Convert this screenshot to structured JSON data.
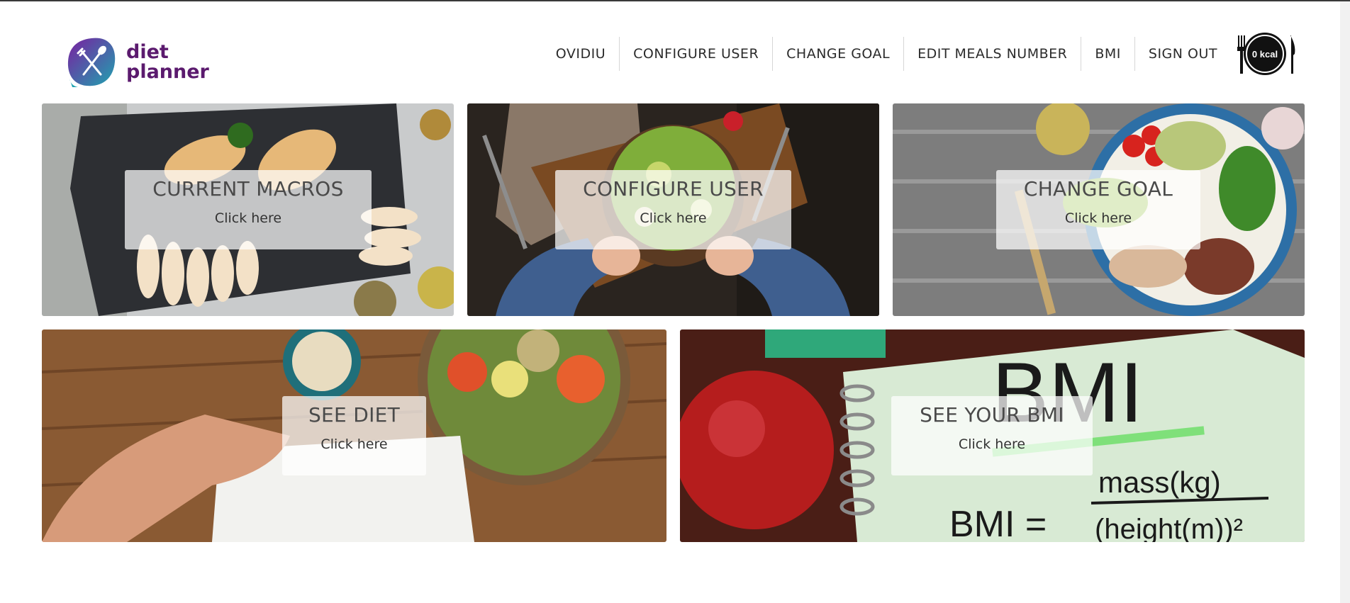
{
  "app": {
    "brand_line1": "diet",
    "brand_line2": "planner",
    "calories": "0 kcal"
  },
  "nav": {
    "items": [
      {
        "label": "OVIDIU"
      },
      {
        "label": "CONFIGURE USER"
      },
      {
        "label": "CHANGE GOAL"
      },
      {
        "label": "EDIT MEALS NUMBER"
      },
      {
        "label": "BMI"
      },
      {
        "label": "SIGN OUT"
      }
    ]
  },
  "cards": [
    {
      "title": "CURRENT MACROS",
      "action": "Click here",
      "image": "grilled-chicken-slate"
    },
    {
      "title": "CONFIGURE USER",
      "action": "Click here",
      "image": "salad-bowl-hands"
    },
    {
      "title": "CHANGE GOAL",
      "action": "Click here",
      "image": "chicken-quinoa-plate"
    },
    {
      "title": "SEE DIET",
      "action": "Click here",
      "image": "salad-notebook-table"
    },
    {
      "title": "SEE YOUR BMI",
      "action": "Click here",
      "image": "apple-bmi-notebook"
    }
  ],
  "colors": {
    "brand_purple": "#5b1a6e",
    "logo_gradient_start": "#7a1fa0",
    "logo_gradient_end": "#1fa3b0",
    "overlay": "rgba(255,255,255,0.72)"
  },
  "bmi_image_text": {
    "heading": "BMI",
    "formula_left": "BMI =",
    "numerator": "mass(kg)",
    "denominator": "(height(m))²"
  }
}
